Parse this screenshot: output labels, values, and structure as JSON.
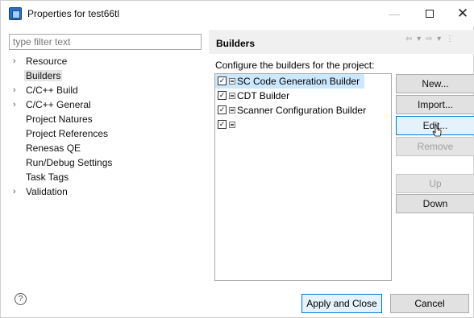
{
  "window": {
    "title": "Properties for test66tl",
    "minimize_glyph": "—",
    "close_glyph": "✕"
  },
  "filter": {
    "placeholder": "type filter text"
  },
  "tree": [
    {
      "label": "Resource",
      "expandable": true
    },
    {
      "label": "Builders",
      "expandable": false,
      "selected": true
    },
    {
      "label": "C/C++ Build",
      "expandable": true
    },
    {
      "label": "C/C++ General",
      "expandable": true
    },
    {
      "label": "Project Natures",
      "expandable": false
    },
    {
      "label": "Project References",
      "expandable": false
    },
    {
      "label": "Renesas QE",
      "expandable": false
    },
    {
      "label": "Run/Debug Settings",
      "expandable": false
    },
    {
      "label": "Task Tags",
      "expandable": false
    },
    {
      "label": "Validation",
      "expandable": true
    }
  ],
  "panel": {
    "title": "Builders",
    "description": "Configure the builders for the project:",
    "nav": {
      "back": "⇦",
      "back_menu": "▾",
      "forward": "⇨",
      "forward_menu": "▾",
      "more": "⋮"
    }
  },
  "builders": [
    {
      "label": "SC Code Generation Builder",
      "checked": true,
      "highlighted": true
    },
    {
      "label": "CDT Builder",
      "checked": true
    },
    {
      "label": "Scanner Configuration Builder",
      "checked": true
    },
    {
      "label": "",
      "checked": true
    }
  ],
  "buttons": {
    "new": "New...",
    "import": "Import...",
    "edit": "Edit...",
    "remove": "Remove",
    "up": "Up",
    "down": "Down",
    "apply_close": "Apply and Close",
    "cancel": "Cancel",
    "help": "?"
  },
  "checkmark": "✓",
  "tree_chevron": "›"
}
